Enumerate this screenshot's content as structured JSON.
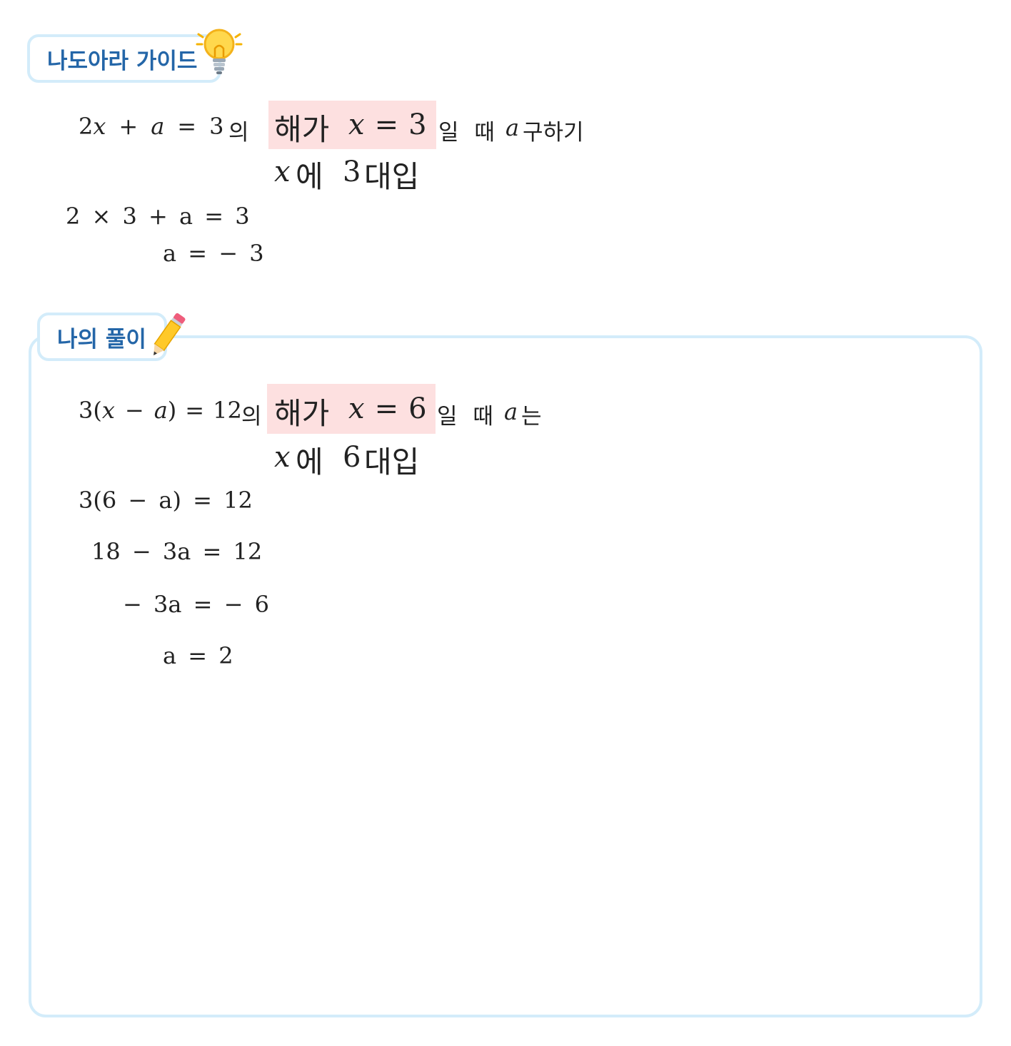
{
  "guide": {
    "title": "나도아라 가이드",
    "intro": {
      "eq": "2x + a = 3",
      "eq_suffix": "의",
      "hl_word": "해가",
      "cond": "x = 3",
      "after": "일 때",
      "var": "a",
      "goal": "구하기"
    },
    "sub": {
      "var": "x",
      "w1": "에",
      "num": "3",
      "w2": "대입"
    },
    "steps": [
      "2 × 3 + a = 3",
      "a = − 3"
    ]
  },
  "mine": {
    "title": "나의 풀이",
    "intro": {
      "eq": "3(x − a) = 12",
      "eq_suffix": "의",
      "hl_word": "해가",
      "cond": "x = 6",
      "after": "일 때",
      "var": "a",
      "goal": "는"
    },
    "sub": {
      "var": "x",
      "w1": "에",
      "num": "6",
      "w2": "대입"
    },
    "steps": [
      "3(6 − a) = 12",
      "18 − 3a = 12",
      "− 3a = − 6",
      "a = 2"
    ]
  },
  "icons": {
    "guide": "lightbulb-icon",
    "mine": "pencil-icon"
  },
  "colors": {
    "tab_border": "#d3ecfa",
    "tab_text": "#2466a8",
    "highlight": "#fde0e0"
  }
}
